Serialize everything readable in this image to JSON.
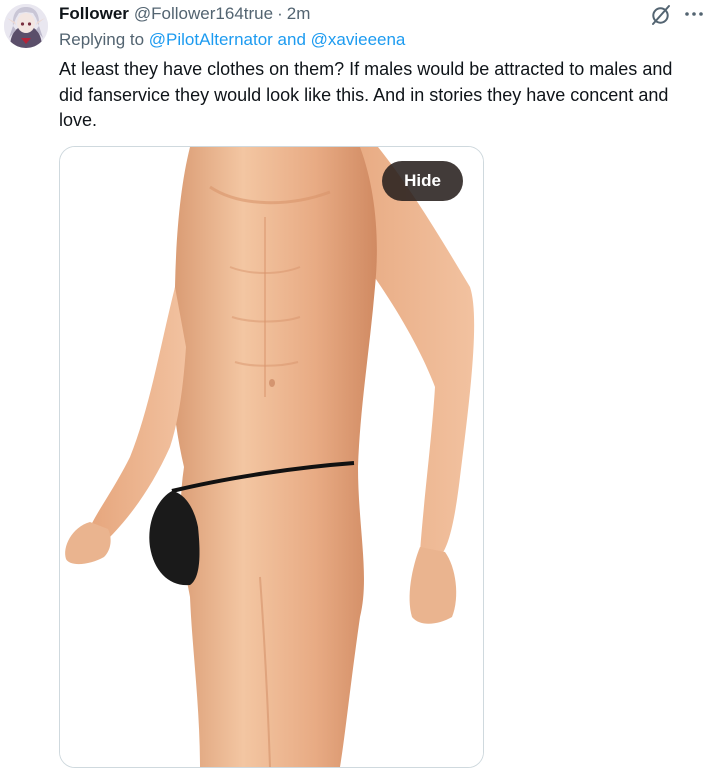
{
  "tweet": {
    "author_name": "Follower",
    "author_handle": "@Follower164true",
    "separator": "·",
    "time": "2m",
    "replying_prefix": "Replying to ",
    "replying_mention_1": "@PilotAlternator",
    "replying_joiner": " and ",
    "replying_mention_2": "@xavieeena",
    "text": "At least they have clothes on them? If males would be attracted to males and did fanservice they would look like this. And in stories they have concent and love.",
    "media_button_label": "Hide"
  },
  "icons": {
    "avatar": "avatar-icon",
    "grok": "grok-icon",
    "more": "more-icon"
  },
  "colors": {
    "text_primary": "#0f1419",
    "text_secondary": "#536471",
    "link": "#1d9bf0",
    "border": "#cfd9de",
    "hide_button_bg": "#28201e"
  }
}
